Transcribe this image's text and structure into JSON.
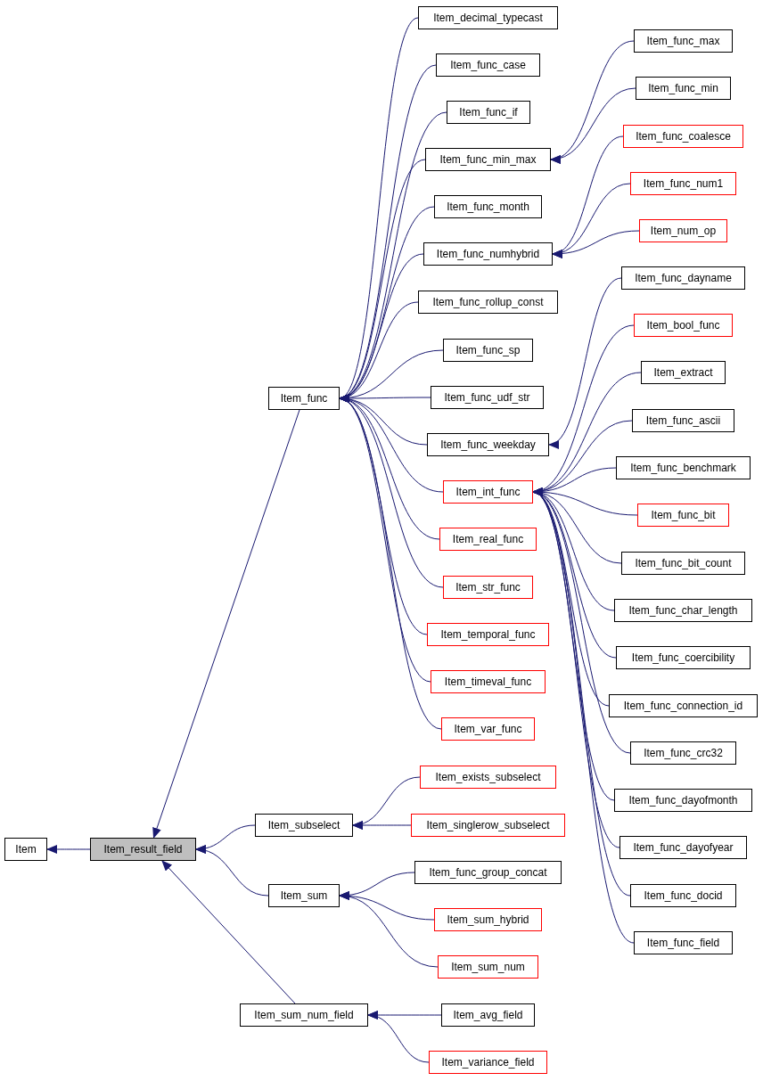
{
  "graph": {
    "root": {
      "label": "Item",
      "current": false,
      "truncated": false,
      "children": [
        {
          "label": "Item_result_field",
          "current": true,
          "truncated": false,
          "children": [
            {
              "label": "Item_func",
              "current": false,
              "truncated": false,
              "children": [
                {
                  "label": "Item_decimal_typecast",
                  "current": false,
                  "truncated": false
                },
                {
                  "label": "Item_func_case",
                  "current": false,
                  "truncated": false
                },
                {
                  "label": "Item_func_if",
                  "current": false,
                  "truncated": false
                },
                {
                  "label": "Item_func_min_max",
                  "current": false,
                  "truncated": false,
                  "children": [
                    {
                      "label": "Item_func_max",
                      "current": false,
                      "truncated": false
                    },
                    {
                      "label": "Item_func_min",
                      "current": false,
                      "truncated": false
                    }
                  ]
                },
                {
                  "label": "Item_func_month",
                  "current": false,
                  "truncated": false
                },
                {
                  "label": "Item_func_numhybrid",
                  "current": false,
                  "truncated": false,
                  "children": [
                    {
                      "label": "Item_func_coalesce",
                      "current": false,
                      "truncated": true
                    },
                    {
                      "label": "Item_func_num1",
                      "current": false,
                      "truncated": true
                    },
                    {
                      "label": "Item_num_op",
                      "current": false,
                      "truncated": true
                    }
                  ]
                },
                {
                  "label": "Item_func_rollup_const",
                  "current": false,
                  "truncated": false
                },
                {
                  "label": "Item_func_sp",
                  "current": false,
                  "truncated": false
                },
                {
                  "label": "Item_func_udf_str",
                  "current": false,
                  "truncated": false
                },
                {
                  "label": "Item_func_weekday",
                  "current": false,
                  "truncated": false,
                  "children": [
                    {
                      "label": "Item_func_dayname",
                      "current": false,
                      "truncated": false
                    }
                  ]
                },
                {
                  "label": "Item_int_func",
                  "current": false,
                  "truncated": true,
                  "children": [
                    {
                      "label": "Item_bool_func",
                      "current": false,
                      "truncated": true
                    },
                    {
                      "label": "Item_extract",
                      "current": false,
                      "truncated": false
                    },
                    {
                      "label": "Item_func_ascii",
                      "current": false,
                      "truncated": false
                    },
                    {
                      "label": "Item_func_benchmark",
                      "current": false,
                      "truncated": false
                    },
                    {
                      "label": "Item_func_bit",
                      "current": false,
                      "truncated": true
                    },
                    {
                      "label": "Item_func_bit_count",
                      "current": false,
                      "truncated": false
                    },
                    {
                      "label": "Item_func_char_length",
                      "current": false,
                      "truncated": false
                    },
                    {
                      "label": "Item_func_coercibility",
                      "current": false,
                      "truncated": false
                    },
                    {
                      "label": "Item_func_connection_id",
                      "current": false,
                      "truncated": false
                    },
                    {
                      "label": "Item_func_crc32",
                      "current": false,
                      "truncated": false
                    },
                    {
                      "label": "Item_func_dayofmonth",
                      "current": false,
                      "truncated": false
                    },
                    {
                      "label": "Item_func_dayofyear",
                      "current": false,
                      "truncated": false
                    },
                    {
                      "label": "Item_func_docid",
                      "current": false,
                      "truncated": false
                    },
                    {
                      "label": "Item_func_field",
                      "current": false,
                      "truncated": false
                    }
                  ]
                },
                {
                  "label": "Item_real_func",
                  "current": false,
                  "truncated": true
                },
                {
                  "label": "Item_str_func",
                  "current": false,
                  "truncated": true
                },
                {
                  "label": "Item_temporal_func",
                  "current": false,
                  "truncated": true
                },
                {
                  "label": "Item_timeval_func",
                  "current": false,
                  "truncated": true
                },
                {
                  "label": "Item_var_func",
                  "current": false,
                  "truncated": true
                }
              ]
            },
            {
              "label": "Item_subselect",
              "current": false,
              "truncated": false,
              "children": [
                {
                  "label": "Item_exists_subselect",
                  "current": false,
                  "truncated": true
                },
                {
                  "label": "Item_singlerow_subselect",
                  "current": false,
                  "truncated": true
                }
              ]
            },
            {
              "label": "Item_sum",
              "current": false,
              "truncated": false,
              "children": [
                {
                  "label": "Item_func_group_concat",
                  "current": false,
                  "truncated": false
                },
                {
                  "label": "Item_sum_hybrid",
                  "current": false,
                  "truncated": true
                },
                {
                  "label": "Item_sum_num",
                  "current": false,
                  "truncated": true
                }
              ]
            },
            {
              "label": "Item_sum_num_field",
              "current": false,
              "truncated": false,
              "children": [
                {
                  "label": "Item_avg_field",
                  "current": false,
                  "truncated": false
                },
                {
                  "label": "Item_variance_field",
                  "current": false,
                  "truncated": true
                }
              ]
            }
          ]
        }
      ]
    }
  }
}
